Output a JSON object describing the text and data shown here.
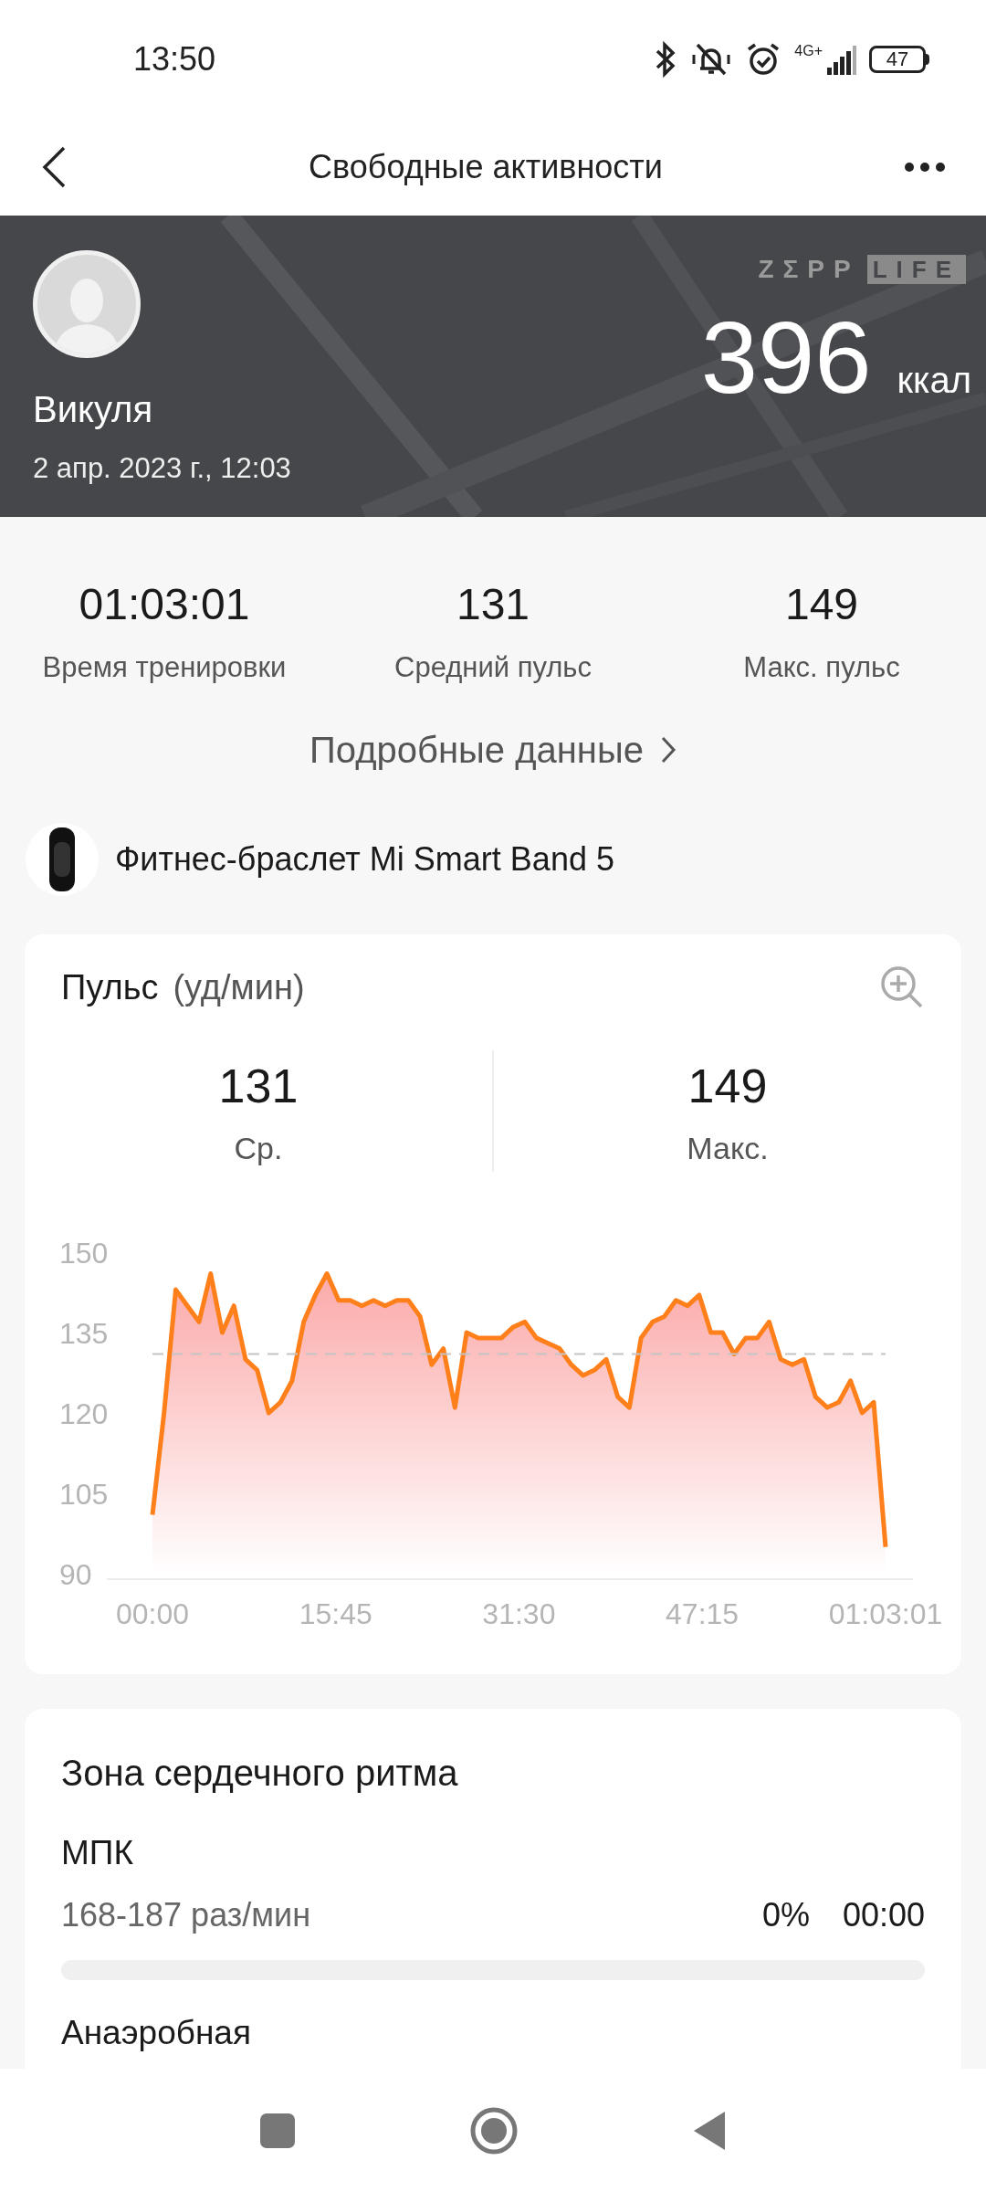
{
  "status_bar": {
    "time": "13:50",
    "network": "4G+",
    "battery": "47"
  },
  "header": {
    "title": "Свободные активности"
  },
  "banner": {
    "logo_left": "ZΣPP",
    "logo_right": "LIFE",
    "name": "Викуля",
    "date": "2 апр. 2023 г., 12:03",
    "calories": "396",
    "calories_unit": "ккал"
  },
  "stats": [
    {
      "value": "01:03:01",
      "label": "Время тренировки"
    },
    {
      "value": "131",
      "label": "Средний пульс"
    },
    {
      "value": "149",
      "label": "Макс. пульс"
    }
  ],
  "details_link": "Подробные данные",
  "device": {
    "name": "Фитнес-браслет Mi Smart Band 5"
  },
  "pulse_card": {
    "title": "Пульс",
    "unit": "(уд/мин)",
    "summary": [
      {
        "value": "131",
        "label": "Ср."
      },
      {
        "value": "149",
        "label": "Макс."
      }
    ],
    "chart_data": {
      "type": "area",
      "x": [
        0,
        1,
        2,
        3,
        4,
        5,
        6,
        7,
        8,
        9,
        10,
        11,
        12,
        13,
        14,
        15,
        16,
        17,
        18,
        19,
        20,
        21,
        22,
        23,
        24,
        25,
        26,
        27,
        28,
        29,
        30,
        31,
        32,
        33,
        34,
        35,
        36,
        37,
        38,
        39,
        40,
        41,
        42,
        43,
        44,
        45,
        46,
        47,
        48,
        49,
        50,
        51,
        52,
        53,
        54,
        55,
        56,
        57,
        58,
        59,
        60,
        61,
        62,
        63.0167
      ],
      "series": [
        {
          "color": "#ff7f1a",
          "values": [
            101,
            120,
            143,
            140,
            137,
            146,
            135,
            140,
            130,
            128,
            120,
            122,
            126,
            137,
            142,
            146,
            141,
            141,
            140,
            141,
            140,
            141,
            141,
            138,
            129,
            132,
            121,
            135,
            134,
            134,
            134,
            136,
            137,
            134,
            133,
            132,
            129,
            127,
            128,
            130,
            123,
            121,
            134,
            137,
            138,
            141,
            140,
            142,
            135,
            135,
            131,
            134,
            134,
            137,
            130,
            129,
            130,
            123,
            121,
            122,
            126,
            120,
            122,
            95
          ]
        }
      ],
      "xlim": [
        0,
        63.0167
      ],
      "ylim": [
        90,
        150
      ],
      "xticks": [
        {
          "value": 0,
          "label": "00:00"
        },
        {
          "value": 15.75,
          "label": "15:45"
        },
        {
          "value": 31.5,
          "label": "31:30"
        },
        {
          "value": 47.25,
          "label": "47:15"
        },
        {
          "value": 63.0167,
          "label": "01:03:01"
        }
      ],
      "yticks": [
        90,
        105,
        120,
        135,
        150
      ],
      "ref_lines": [
        {
          "axis": "y",
          "value": 131
        }
      ]
    }
  },
  "zone_card": {
    "title": "Зона сердечного ритма",
    "zones": [
      {
        "name": "МПК",
        "range": "168-187 раз/мин",
        "percent": "0%",
        "time": "00:00",
        "level": 0
      },
      {
        "name": "Анаэробная"
      }
    ]
  }
}
